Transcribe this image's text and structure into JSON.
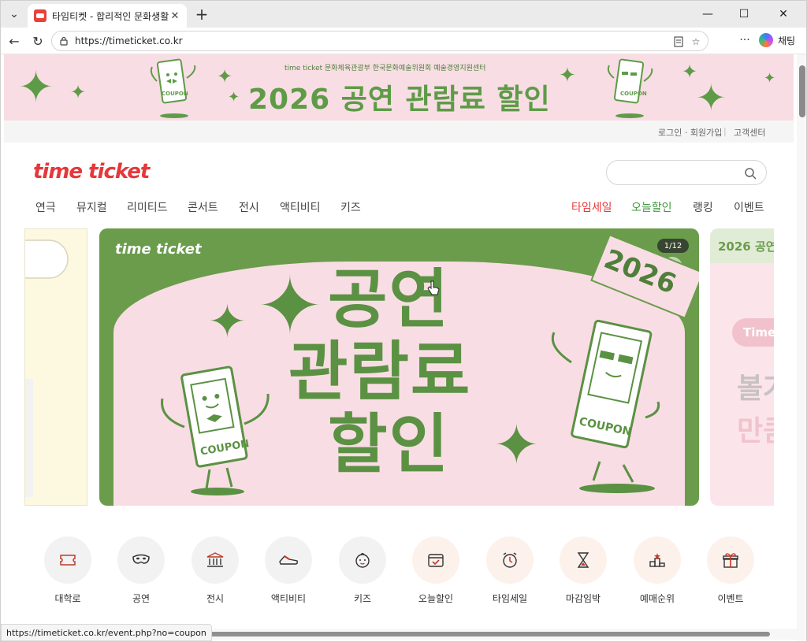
{
  "browser": {
    "tab_title": "타임티켓 - 합리적인 문화생활",
    "url": "https://timeticket.co.kr",
    "copilot_label": "채팅",
    "status_url": "https://timeticket.co.kr/event.php?no=coupon"
  },
  "promo_banner": {
    "title": "2026 공연 관람료 할인",
    "partner_logos": "time ticket   문화체육관광부   한국문화예술위원회   예술경영지원센터",
    "brand_color": "#5e9b47",
    "background": "#f8dde4"
  },
  "util_links": {
    "login": "로그인 · 회원가입",
    "separator": "|",
    "help": "고객센터"
  },
  "header": {
    "logo": "time ticket",
    "logo_color": "#e5383b",
    "search_placeholder": ""
  },
  "nav": {
    "left": [
      "연극",
      "뮤지컬",
      "리미티드",
      "콘서트",
      "전시",
      "액티비티",
      "키즈"
    ],
    "right": [
      {
        "label": "타임세일",
        "color": "#e5383b"
      },
      {
        "label": "오늘할인",
        "color": "#3f9a3f"
      },
      {
        "label": "랭킹",
        "color": "#444444"
      },
      {
        "label": "이벤트",
        "color": "#444444"
      }
    ]
  },
  "carousel": {
    "counter": "1/12",
    "main_slide": {
      "brand": "time ticket",
      "year": "2026",
      "line1": "공연",
      "line2": "관람료",
      "line3": "할인",
      "coupon_label": "COUPON"
    },
    "next_slide": {
      "header": "2026 공연",
      "badge": "Time",
      "line1": "볼거",
      "line2": "만큼"
    }
  },
  "categories": [
    {
      "label": "대학로",
      "icon": "ticket-icon",
      "bg": "#f2f2f2"
    },
    {
      "label": "공연",
      "icon": "mask-icon",
      "bg": "#f2f2f2"
    },
    {
      "label": "전시",
      "icon": "museum-icon",
      "bg": "#f2f2f2"
    },
    {
      "label": "액티비티",
      "icon": "sneaker-icon",
      "bg": "#f2f2f2"
    },
    {
      "label": "키즈",
      "icon": "baby-face-icon",
      "bg": "#f2f2f2"
    },
    {
      "label": "오늘할인",
      "icon": "calendar-check-icon",
      "bg": "#fdf1ec"
    },
    {
      "label": "타임세일",
      "icon": "alarm-clock-icon",
      "bg": "#fdf1ec"
    },
    {
      "label": "마감임박",
      "icon": "hourglass-icon",
      "bg": "#fdf1ec"
    },
    {
      "label": "예매순위",
      "icon": "podium-icon",
      "bg": "#fdf1ec"
    },
    {
      "label": "이벤트",
      "icon": "gift-icon",
      "bg": "#fdf1ec"
    }
  ]
}
